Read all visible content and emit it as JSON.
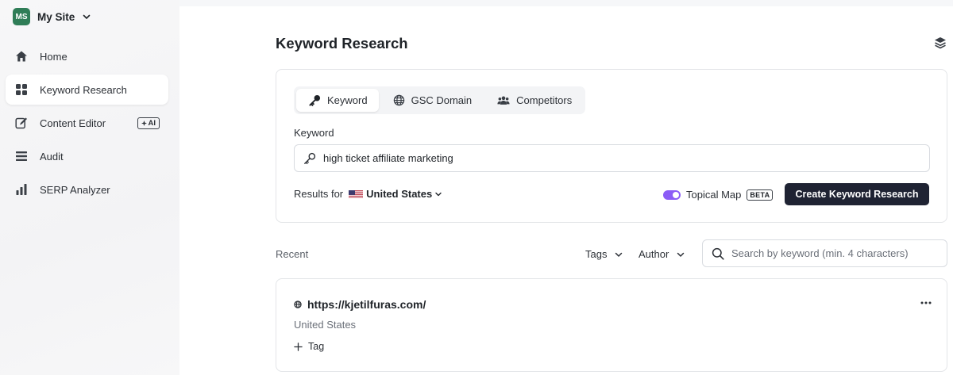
{
  "site": {
    "badge": "MS",
    "name": "My Site"
  },
  "sidebar": {
    "items": [
      {
        "label": "Home",
        "icon": "home-icon"
      },
      {
        "label": "Keyword Research",
        "icon": "grid-icon",
        "active": true
      },
      {
        "label": "Content Editor",
        "icon": "edit-icon",
        "badge": "AI"
      },
      {
        "label": "Audit",
        "icon": "list-icon"
      },
      {
        "label": "SERP Analyzer",
        "icon": "bar-chart-icon"
      }
    ]
  },
  "page": {
    "title": "Keyword Research"
  },
  "form": {
    "tabs": [
      {
        "label": "Keyword",
        "icon": "key-icon",
        "active": true
      },
      {
        "label": "GSC Domain",
        "icon": "globe-icon"
      },
      {
        "label": "Competitors",
        "icon": "users-icon"
      }
    ],
    "field_label": "Keyword",
    "keyword_value": "high ticket affiliate marketing",
    "results_for_label": "Results for",
    "country": "United States",
    "topical_map_label": "Topical Map",
    "topical_map_enabled": true,
    "beta_label": "BETA",
    "create_button": "Create Keyword Research",
    "accent_color": "#8b5cf6",
    "button_color": "#1f2333"
  },
  "recent": {
    "label": "Recent",
    "filters": {
      "tags": "Tags",
      "author": "Author"
    },
    "search_placeholder": "Search by keyword (min. 4 characters)",
    "items": [
      {
        "title": "https://kjetilfuras.com/",
        "country": "United States",
        "add_tag": "Tag"
      }
    ]
  }
}
